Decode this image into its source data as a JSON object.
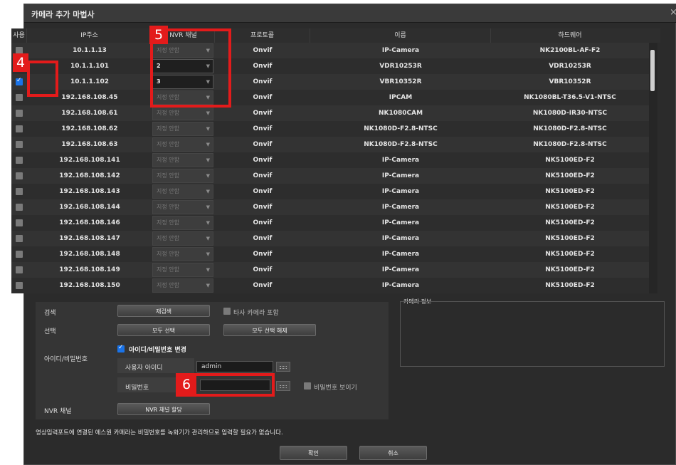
{
  "window": {
    "title": "카메라 추가 마법사",
    "close": "×"
  },
  "table": {
    "headers": {
      "use": "사용",
      "ip": "IP주소",
      "channel": "NVR 채널",
      "protocol": "프로토콜",
      "name": "이름",
      "hardware": "하드웨어"
    },
    "rows": [
      {
        "checked": false,
        "ip": "10.1.1.13",
        "channel": "지정 안함",
        "assigned": false,
        "protocol": "Onvif",
        "name": "IP-Camera",
        "hardware": "NK2100BL-AF-F2"
      },
      {
        "checked": true,
        "ip": "10.1.1.101",
        "channel": "2",
        "assigned": true,
        "protocol": "Onvif",
        "name": "VDR10253R",
        "hardware": "VDR10253R"
      },
      {
        "checked": true,
        "ip": "10.1.1.102",
        "channel": "3",
        "assigned": true,
        "protocol": "Onvif",
        "name": "VBR10352R",
        "hardware": "VBR10352R"
      },
      {
        "checked": false,
        "ip": "192.168.108.45",
        "channel": "지정 안함",
        "assigned": false,
        "protocol": "Onvif",
        "name": "IPCAM",
        "hardware": "NK1080BL-T36.5-V1-NTSC"
      },
      {
        "checked": false,
        "ip": "192.168.108.61",
        "channel": "지정 안함",
        "assigned": false,
        "protocol": "Onvif",
        "name": "NK1080CAM",
        "hardware": "NK1080D-IR30-NTSC"
      },
      {
        "checked": false,
        "ip": "192.168.108.62",
        "channel": "지정 안함",
        "assigned": false,
        "protocol": "Onvif",
        "name": "NK1080D-F2.8-NTSC",
        "hardware": "NK1080D-F2.8-NTSC"
      },
      {
        "checked": false,
        "ip": "192.168.108.63",
        "channel": "지정 안함",
        "assigned": false,
        "protocol": "Onvif",
        "name": "NK1080D-F2.8-NTSC",
        "hardware": "NK1080D-F2.8-NTSC"
      },
      {
        "checked": false,
        "ip": "192.168.108.141",
        "channel": "지정 안함",
        "assigned": false,
        "protocol": "Onvif",
        "name": "IP-Camera",
        "hardware": "NK5100ED-F2"
      },
      {
        "checked": false,
        "ip": "192.168.108.142",
        "channel": "지정 안함",
        "assigned": false,
        "protocol": "Onvif",
        "name": "IP-Camera",
        "hardware": "NK5100ED-F2"
      },
      {
        "checked": false,
        "ip": "192.168.108.143",
        "channel": "지정 안함",
        "assigned": false,
        "protocol": "Onvif",
        "name": "IP-Camera",
        "hardware": "NK5100ED-F2"
      },
      {
        "checked": false,
        "ip": "192.168.108.144",
        "channel": "지정 안함",
        "assigned": false,
        "protocol": "Onvif",
        "name": "IP-Camera",
        "hardware": "NK5100ED-F2"
      },
      {
        "checked": false,
        "ip": "192.168.108.146",
        "channel": "지정 안함",
        "assigned": false,
        "protocol": "Onvif",
        "name": "IP-Camera",
        "hardware": "NK5100ED-F2"
      },
      {
        "checked": false,
        "ip": "192.168.108.147",
        "channel": "지정 안함",
        "assigned": false,
        "protocol": "Onvif",
        "name": "IP-Camera",
        "hardware": "NK5100ED-F2"
      },
      {
        "checked": false,
        "ip": "192.168.108.148",
        "channel": "지정 안함",
        "assigned": false,
        "protocol": "Onvif",
        "name": "IP-Camera",
        "hardware": "NK5100ED-F2"
      },
      {
        "checked": false,
        "ip": "192.168.108.149",
        "channel": "지정 안함",
        "assigned": false,
        "protocol": "Onvif",
        "name": "IP-Camera",
        "hardware": "NK5100ED-F2"
      },
      {
        "checked": false,
        "ip": "192.168.108.150",
        "channel": "지정 안함",
        "assigned": false,
        "protocol": "Onvif",
        "name": "IP-Camera",
        "hardware": "NK5100ED-F2"
      }
    ]
  },
  "search": {
    "label": "검색",
    "rescan_button": "재검색",
    "third_party_label": "타사 카메라 포함",
    "third_party_checked": false
  },
  "select": {
    "label": "선택",
    "select_all_button": "모두 선택",
    "deselect_all_button": "모두 선택 해제"
  },
  "credentials": {
    "label": "아이디/비밀번호",
    "change_label": "아이디/비밀번호 변경",
    "change_checked": true,
    "user_id_label": "사용자 아이디",
    "user_id_value": "admin",
    "password_label": "비밀번호",
    "password_value": "",
    "show_password_label": "비밀번호 보이기",
    "show_password_checked": false
  },
  "nvr_channel": {
    "label": "NVR 채널",
    "assign_button": "NVR 채널 할당"
  },
  "camera_info": {
    "title": "카메라 정보"
  },
  "notice": "영상입력포트에 연결된 에스원 카메라는 비밀번호를 녹화기가 관리하므로 입력할 필요가 없습니다.",
  "footer": {
    "ok_button": "확인",
    "cancel_button": "취소"
  },
  "annotations": {
    "badge_4": "4",
    "badge_5": "5",
    "badge_6": "6"
  },
  "colors": {
    "accent": "#1a73e8",
    "highlight": "#e31b1b"
  }
}
